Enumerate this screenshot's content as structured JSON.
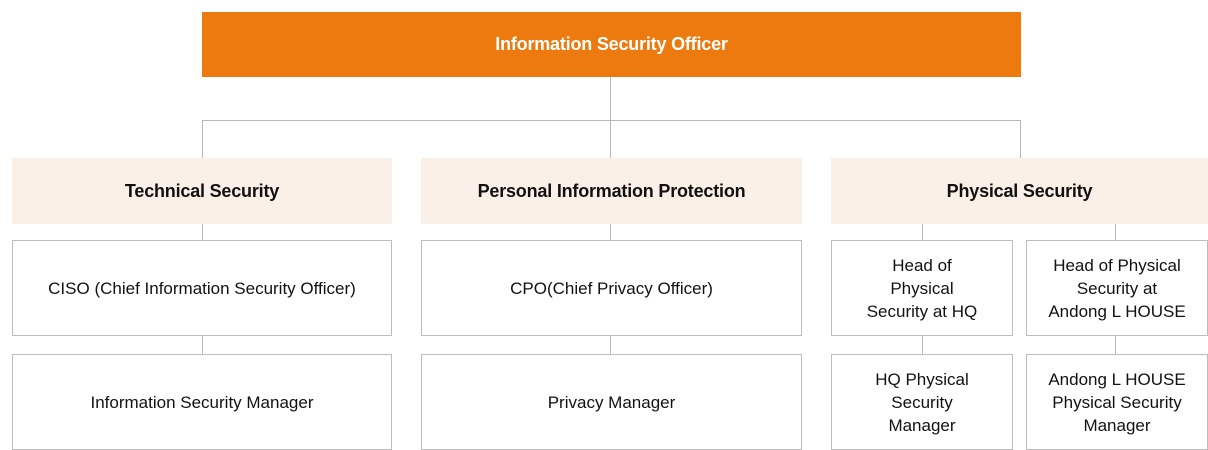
{
  "top": {
    "title": "Information Security Officer"
  },
  "columns": [
    {
      "heading": "Technical Security",
      "roles": [
        "CISO (Chief Information Security Officer)",
        "Information Security Manager"
      ]
    },
    {
      "heading": "Personal Information Protection",
      "roles": [
        "CPO(Chief Privacy Officer)",
        "Privacy Manager"
      ]
    },
    {
      "heading": "Physical Security",
      "branches": [
        {
          "head": "Head of\nPhysical\nSecurity at HQ",
          "manager": "HQ Physical\nSecurity\nManager"
        },
        {
          "head": "Head of Physical\nSecurity at\nAndong L HOUSE",
          "manager": "Andong L HOUSE\nPhysical Security\nManager"
        }
      ]
    }
  ],
  "colors": {
    "accent": "#ec7a0f",
    "heading_bg": "#fbf0e7",
    "connector": "#b8b8b8",
    "cell_border": "#bdbdbd"
  }
}
